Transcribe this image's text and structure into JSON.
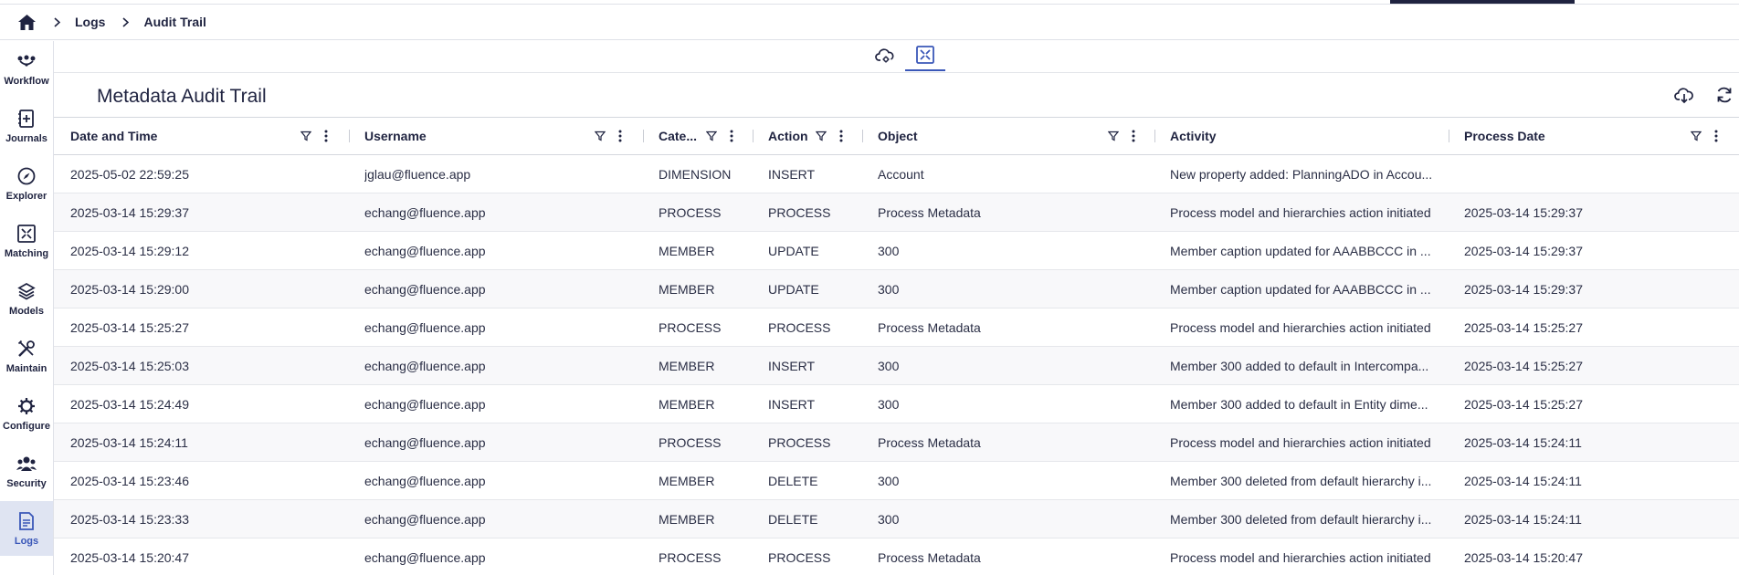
{
  "breadcrumb": {
    "items": [
      "Logs",
      "Audit Trail"
    ]
  },
  "sidebar": {
    "items": [
      {
        "label": "Workflow",
        "icon": "workflow-icon"
      },
      {
        "label": "Journals",
        "icon": "journals-icon"
      },
      {
        "label": "Explorer",
        "icon": "compass-icon"
      },
      {
        "label": "Matching",
        "icon": "matching-icon"
      },
      {
        "label": "Models",
        "icon": "layers-icon"
      },
      {
        "label": "Maintain",
        "icon": "tools-icon"
      },
      {
        "label": "Configure",
        "icon": "gear-icon"
      },
      {
        "label": "Security",
        "icon": "users-icon"
      },
      {
        "label": "Logs",
        "icon": "document-icon",
        "active": true
      }
    ]
  },
  "page": {
    "title": "Metadata Audit Trail"
  },
  "colors": {
    "accent": "#3a57b8",
    "text": "#1f2340",
    "active_bg": "#dfe4f2"
  },
  "table": {
    "columns": [
      "Date and Time",
      "Username",
      "Cate...",
      "Action",
      "Object",
      "Activity",
      "Process Date"
    ],
    "rows": [
      [
        "2025-05-02 22:59:25",
        "jglau@fluence.app",
        "DIMENSION",
        "INSERT",
        "Account",
        "New property added: PlanningADO in Accou...",
        ""
      ],
      [
        "2025-03-14 15:29:37",
        "echang@fluence.app",
        "PROCESS",
        "PROCESS",
        "Process Metadata",
        "Process model and hierarchies action initiated",
        "2025-03-14 15:29:37"
      ],
      [
        "2025-03-14 15:29:12",
        "echang@fluence.app",
        "MEMBER",
        "UPDATE",
        "300",
        "Member caption updated for AAABBCCC in ...",
        "2025-03-14 15:29:37"
      ],
      [
        "2025-03-14 15:29:00",
        "echang@fluence.app",
        "MEMBER",
        "UPDATE",
        "300",
        "Member caption updated for AAABBCCC in ...",
        "2025-03-14 15:29:37"
      ],
      [
        "2025-03-14 15:25:27",
        "echang@fluence.app",
        "PROCESS",
        "PROCESS",
        "Process Metadata",
        "Process model and hierarchies action initiated",
        "2025-03-14 15:25:27"
      ],
      [
        "2025-03-14 15:25:03",
        "echang@fluence.app",
        "MEMBER",
        "INSERT",
        "300",
        "Member 300 added to default in Intercompa...",
        "2025-03-14 15:25:27"
      ],
      [
        "2025-03-14 15:24:49",
        "echang@fluence.app",
        "MEMBER",
        "INSERT",
        "300",
        "Member 300 added to default in Entity dime...",
        "2025-03-14 15:25:27"
      ],
      [
        "2025-03-14 15:24:11",
        "echang@fluence.app",
        "PROCESS",
        "PROCESS",
        "Process Metadata",
        "Process model and hierarchies action initiated",
        "2025-03-14 15:24:11"
      ],
      [
        "2025-03-14 15:23:46",
        "echang@fluence.app",
        "MEMBER",
        "DELETE",
        "300",
        "Member 300 deleted from default hierarchy i...",
        "2025-03-14 15:24:11"
      ],
      [
        "2025-03-14 15:23:33",
        "echang@fluence.app",
        "MEMBER",
        "DELETE",
        "300",
        "Member 300 deleted from default hierarchy i...",
        "2025-03-14 15:24:11"
      ],
      [
        "2025-03-14 15:20:47",
        "echang@fluence.app",
        "PROCESS",
        "PROCESS",
        "Process Metadata",
        "Process model and hierarchies action initiated",
        "2025-03-14 15:20:47"
      ]
    ]
  }
}
